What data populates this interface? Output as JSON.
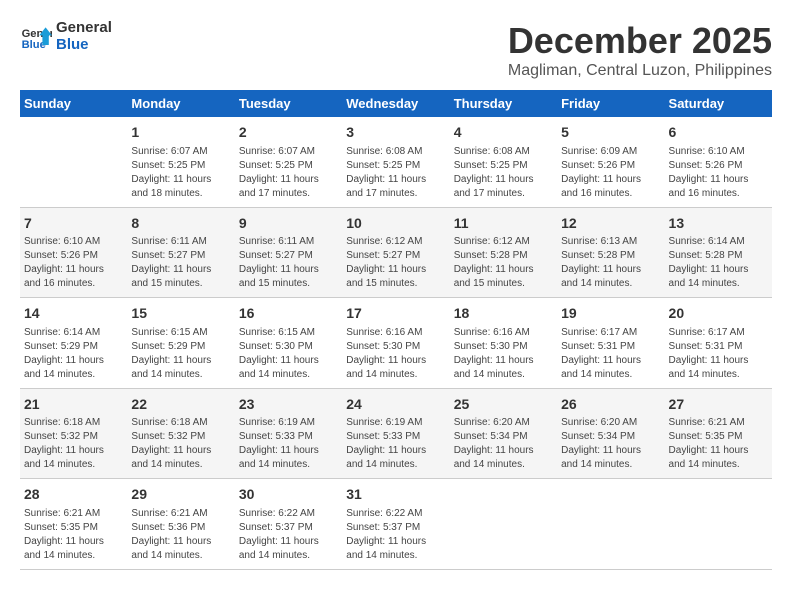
{
  "logo": {
    "line1": "General",
    "line2": "Blue"
  },
  "title": "December 2025",
  "subtitle": "Magliman, Central Luzon, Philippines",
  "days_of_week": [
    "Sunday",
    "Monday",
    "Tuesday",
    "Wednesday",
    "Thursday",
    "Friday",
    "Saturday"
  ],
  "weeks": [
    [
      {
        "day": "",
        "info": ""
      },
      {
        "day": "1",
        "info": "Sunrise: 6:07 AM\nSunset: 5:25 PM\nDaylight: 11 hours\nand 18 minutes."
      },
      {
        "day": "2",
        "info": "Sunrise: 6:07 AM\nSunset: 5:25 PM\nDaylight: 11 hours\nand 17 minutes."
      },
      {
        "day": "3",
        "info": "Sunrise: 6:08 AM\nSunset: 5:25 PM\nDaylight: 11 hours\nand 17 minutes."
      },
      {
        "day": "4",
        "info": "Sunrise: 6:08 AM\nSunset: 5:25 PM\nDaylight: 11 hours\nand 17 minutes."
      },
      {
        "day": "5",
        "info": "Sunrise: 6:09 AM\nSunset: 5:26 PM\nDaylight: 11 hours\nand 16 minutes."
      },
      {
        "day": "6",
        "info": "Sunrise: 6:10 AM\nSunset: 5:26 PM\nDaylight: 11 hours\nand 16 minutes."
      }
    ],
    [
      {
        "day": "7",
        "info": "Sunrise: 6:10 AM\nSunset: 5:26 PM\nDaylight: 11 hours\nand 16 minutes."
      },
      {
        "day": "8",
        "info": "Sunrise: 6:11 AM\nSunset: 5:27 PM\nDaylight: 11 hours\nand 15 minutes."
      },
      {
        "day": "9",
        "info": "Sunrise: 6:11 AM\nSunset: 5:27 PM\nDaylight: 11 hours\nand 15 minutes."
      },
      {
        "day": "10",
        "info": "Sunrise: 6:12 AM\nSunset: 5:27 PM\nDaylight: 11 hours\nand 15 minutes."
      },
      {
        "day": "11",
        "info": "Sunrise: 6:12 AM\nSunset: 5:28 PM\nDaylight: 11 hours\nand 15 minutes."
      },
      {
        "day": "12",
        "info": "Sunrise: 6:13 AM\nSunset: 5:28 PM\nDaylight: 11 hours\nand 14 minutes."
      },
      {
        "day": "13",
        "info": "Sunrise: 6:14 AM\nSunset: 5:28 PM\nDaylight: 11 hours\nand 14 minutes."
      }
    ],
    [
      {
        "day": "14",
        "info": "Sunrise: 6:14 AM\nSunset: 5:29 PM\nDaylight: 11 hours\nand 14 minutes."
      },
      {
        "day": "15",
        "info": "Sunrise: 6:15 AM\nSunset: 5:29 PM\nDaylight: 11 hours\nand 14 minutes."
      },
      {
        "day": "16",
        "info": "Sunrise: 6:15 AM\nSunset: 5:30 PM\nDaylight: 11 hours\nand 14 minutes."
      },
      {
        "day": "17",
        "info": "Sunrise: 6:16 AM\nSunset: 5:30 PM\nDaylight: 11 hours\nand 14 minutes."
      },
      {
        "day": "18",
        "info": "Sunrise: 6:16 AM\nSunset: 5:30 PM\nDaylight: 11 hours\nand 14 minutes."
      },
      {
        "day": "19",
        "info": "Sunrise: 6:17 AM\nSunset: 5:31 PM\nDaylight: 11 hours\nand 14 minutes."
      },
      {
        "day": "20",
        "info": "Sunrise: 6:17 AM\nSunset: 5:31 PM\nDaylight: 11 hours\nand 14 minutes."
      }
    ],
    [
      {
        "day": "21",
        "info": "Sunrise: 6:18 AM\nSunset: 5:32 PM\nDaylight: 11 hours\nand 14 minutes."
      },
      {
        "day": "22",
        "info": "Sunrise: 6:18 AM\nSunset: 5:32 PM\nDaylight: 11 hours\nand 14 minutes."
      },
      {
        "day": "23",
        "info": "Sunrise: 6:19 AM\nSunset: 5:33 PM\nDaylight: 11 hours\nand 14 minutes."
      },
      {
        "day": "24",
        "info": "Sunrise: 6:19 AM\nSunset: 5:33 PM\nDaylight: 11 hours\nand 14 minutes."
      },
      {
        "day": "25",
        "info": "Sunrise: 6:20 AM\nSunset: 5:34 PM\nDaylight: 11 hours\nand 14 minutes."
      },
      {
        "day": "26",
        "info": "Sunrise: 6:20 AM\nSunset: 5:34 PM\nDaylight: 11 hours\nand 14 minutes."
      },
      {
        "day": "27",
        "info": "Sunrise: 6:21 AM\nSunset: 5:35 PM\nDaylight: 11 hours\nand 14 minutes."
      }
    ],
    [
      {
        "day": "28",
        "info": "Sunrise: 6:21 AM\nSunset: 5:35 PM\nDaylight: 11 hours\nand 14 minutes."
      },
      {
        "day": "29",
        "info": "Sunrise: 6:21 AM\nSunset: 5:36 PM\nDaylight: 11 hours\nand 14 minutes."
      },
      {
        "day": "30",
        "info": "Sunrise: 6:22 AM\nSunset: 5:37 PM\nDaylight: 11 hours\nand 14 minutes."
      },
      {
        "day": "31",
        "info": "Sunrise: 6:22 AM\nSunset: 5:37 PM\nDaylight: 11 hours\nand 14 minutes."
      },
      {
        "day": "",
        "info": ""
      },
      {
        "day": "",
        "info": ""
      },
      {
        "day": "",
        "info": ""
      }
    ]
  ]
}
